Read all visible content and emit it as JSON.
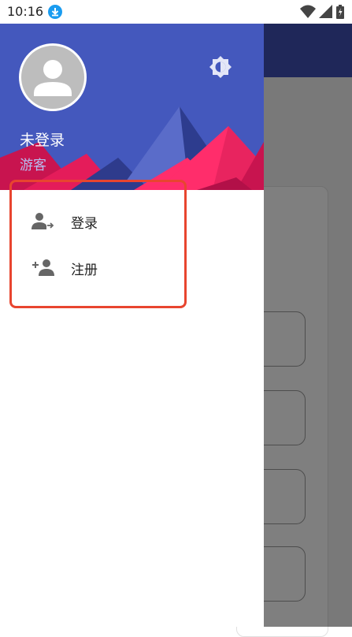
{
  "status_bar": {
    "time": "10:16",
    "icons": [
      "download-icon",
      "wifi-icon",
      "cellular-signal-icon",
      "battery-icon"
    ]
  },
  "drawer": {
    "header": {
      "avatar": "default-avatar-icon",
      "theme_toggle": "brightness-icon",
      "username": "未登录",
      "user_type": "游客",
      "colors": {
        "background": "#4458bd",
        "accent": "#ff2d6b"
      }
    },
    "menu": [
      {
        "label": "登录",
        "icon": "login-user-icon"
      },
      {
        "label": "注册",
        "icon": "add-user-icon"
      }
    ]
  },
  "annotation": {
    "color": "#e8452f"
  }
}
